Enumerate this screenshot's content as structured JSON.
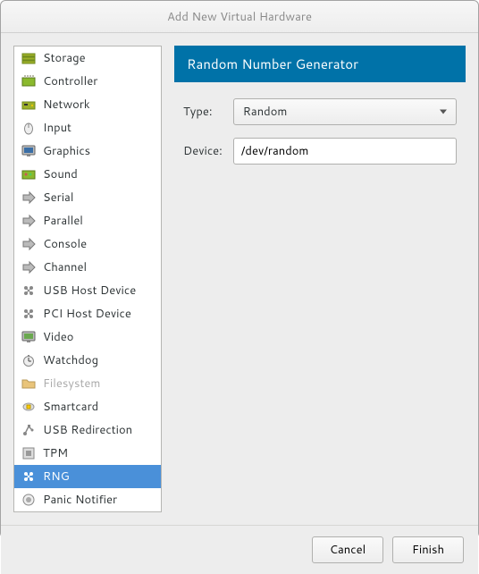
{
  "window": {
    "title": "Add New Virtual Hardware"
  },
  "sidebar": {
    "items": [
      {
        "label": "Storage",
        "icon": "storage",
        "selected": false,
        "disabled": false
      },
      {
        "label": "Controller",
        "icon": "controller",
        "selected": false,
        "disabled": false
      },
      {
        "label": "Network",
        "icon": "network",
        "selected": false,
        "disabled": false
      },
      {
        "label": "Input",
        "icon": "input",
        "selected": false,
        "disabled": false
      },
      {
        "label": "Graphics",
        "icon": "graphics",
        "selected": false,
        "disabled": false
      },
      {
        "label": "Sound",
        "icon": "sound",
        "selected": false,
        "disabled": false
      },
      {
        "label": "Serial",
        "icon": "port",
        "selected": false,
        "disabled": false
      },
      {
        "label": "Parallel",
        "icon": "port",
        "selected": false,
        "disabled": false
      },
      {
        "label": "Console",
        "icon": "port",
        "selected": false,
        "disabled": false
      },
      {
        "label": "Channel",
        "icon": "port",
        "selected": false,
        "disabled": false
      },
      {
        "label": "USB Host Device",
        "icon": "hostdev",
        "selected": false,
        "disabled": false
      },
      {
        "label": "PCI Host Device",
        "icon": "hostdev",
        "selected": false,
        "disabled": false
      },
      {
        "label": "Video",
        "icon": "video",
        "selected": false,
        "disabled": false
      },
      {
        "label": "Watchdog",
        "icon": "watchdog",
        "selected": false,
        "disabled": false
      },
      {
        "label": "Filesystem",
        "icon": "folder",
        "selected": false,
        "disabled": true
      },
      {
        "label": "Smartcard",
        "icon": "smartcard",
        "selected": false,
        "disabled": false
      },
      {
        "label": "USB Redirection",
        "icon": "usbredir",
        "selected": false,
        "disabled": false
      },
      {
        "label": "TPM",
        "icon": "tpm",
        "selected": false,
        "disabled": false
      },
      {
        "label": "RNG",
        "icon": "hostdev",
        "selected": true,
        "disabled": false
      },
      {
        "label": "Panic Notifier",
        "icon": "panic",
        "selected": false,
        "disabled": false
      }
    ]
  },
  "panel": {
    "title": "Random Number Generator",
    "type_label": "Type:",
    "type_value": "Random",
    "device_label": "Device:",
    "device_value": "/dev/random"
  },
  "buttons": {
    "cancel": "Cancel",
    "finish": "Finish"
  }
}
